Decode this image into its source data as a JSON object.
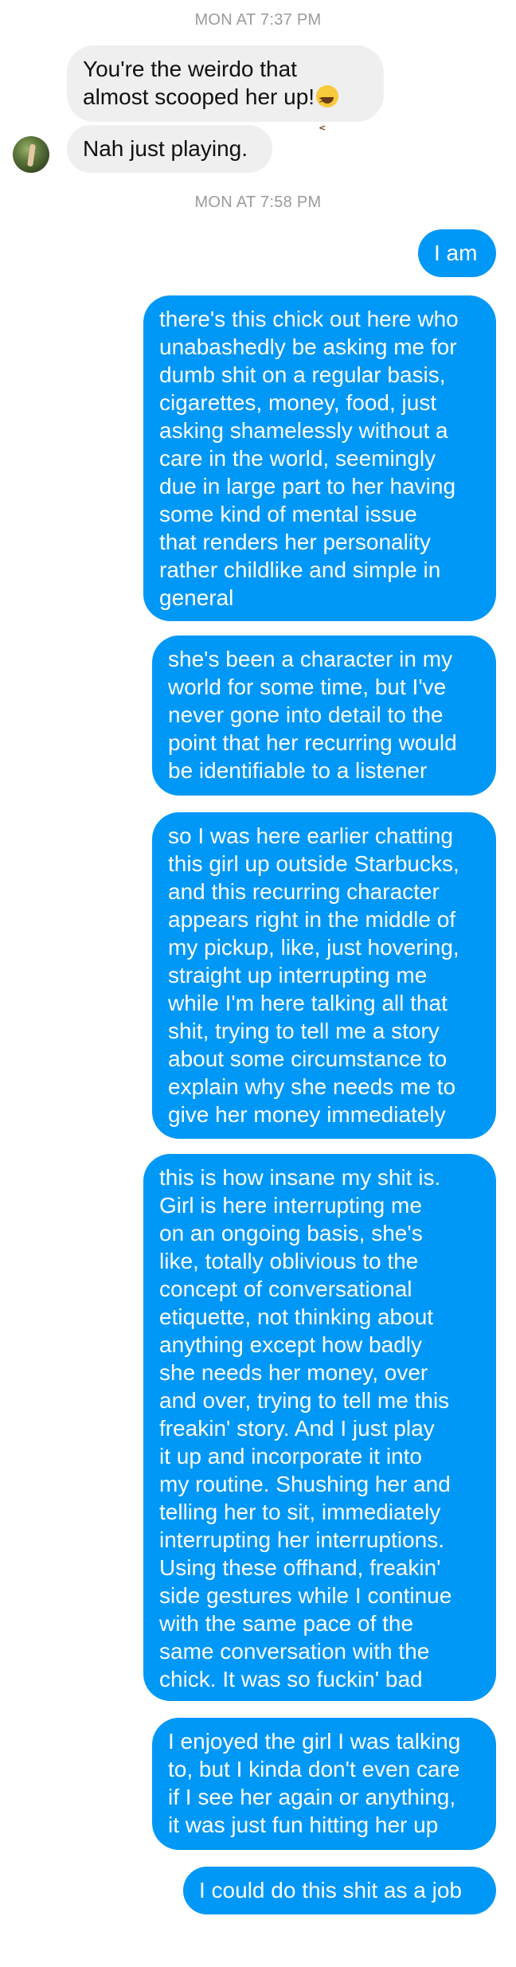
{
  "timestamps": [
    "MON AT 7:37 PM",
    "MON AT 7:58 PM"
  ],
  "incoming": [
    {
      "text": "You're the weirdo that\nalmost scooped her up!",
      "emoji": "laughing-face-icon"
    },
    {
      "text": "Nah just playing."
    }
  ],
  "outgoing": [
    "I am",
    "there's this chick out here who\nunabashedly be asking me for\ndumb shit on a regular basis,\ncigarettes, money, food, just\nasking shamelessly without a\ncare in the world, seemingly\ndue in large part to her having\nsome kind of mental issue\nthat renders her personality\nrather childlike and simple in\ngeneral",
    "she's been a character in my\nworld for some time, but I've\nnever gone into detail to the\npoint that her recurring would\nbe identifiable to a listener",
    "so I was here earlier chatting\nthis girl up outside Starbucks,\nand this recurring character\nappears right in the middle of\nmy pickup, like, just hovering,\nstraight up interrupting me\nwhile I'm here talking all that\nshit, trying to tell me a story\nabout some circumstance to\nexplain why she needs me to\ngive her money immediately",
    "this is how insane my shit is.\nGirl is here interrupting me\non an ongoing basis, she's\nlike, totally oblivious to the\nconcept of conversational\netiquette, not thinking about\nanything except how badly\nshe needs her money, over\nand over, trying to tell me this\nfreakin' story. And I just play\nit up and incorporate it into\nmy routine. Shushing her and\ntelling her to sit, immediately\ninterrupting her interruptions.\nUsing these offhand, freakin'\nside gestures while I continue\nwith the same pace of the\nsame conversation with the\nchick. It was so fuckin' bad",
    "I enjoyed the girl I was talking\nto, but I kinda don't even care\nif I see her again or anything,\nit was just fun hitting her up",
    "I could do this shit as a job"
  ],
  "colors": {
    "outgoing_bubble": "#0098f6",
    "incoming_bubble": "#efefef",
    "timestamp": "#9b9b9b"
  }
}
